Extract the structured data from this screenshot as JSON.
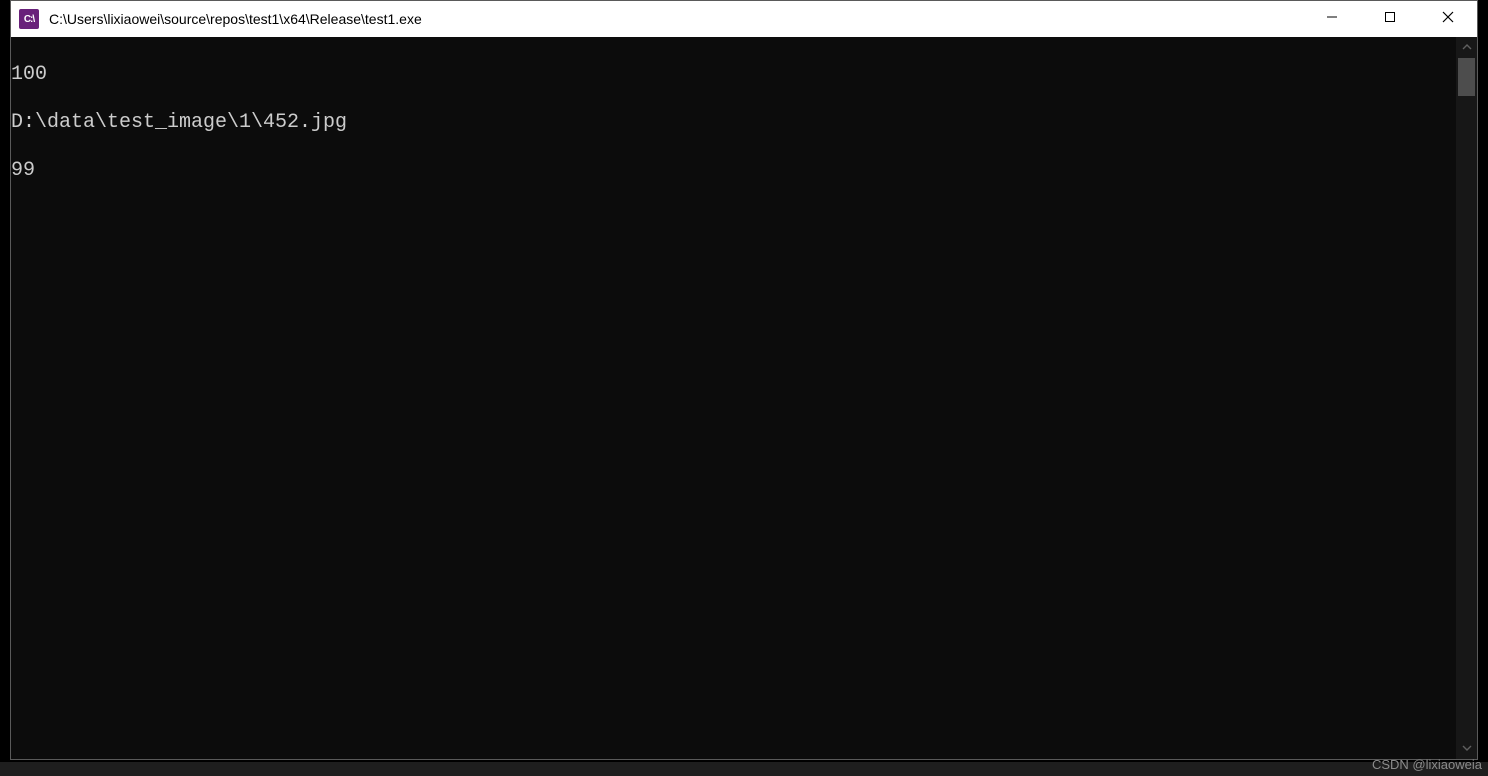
{
  "window": {
    "title": "C:\\Users\\lixiaowei\\source\\repos\\test1\\x64\\Release\\test1.exe",
    "icon_label": "C:\\"
  },
  "console": {
    "lines": [
      "100",
      "D:\\data\\test_image\\1\\452.jpg",
      "99"
    ]
  },
  "watermark": "CSDN @lixiaoweia",
  "editor_hint": {
    "line_no": "",
    "brace": ""
  }
}
